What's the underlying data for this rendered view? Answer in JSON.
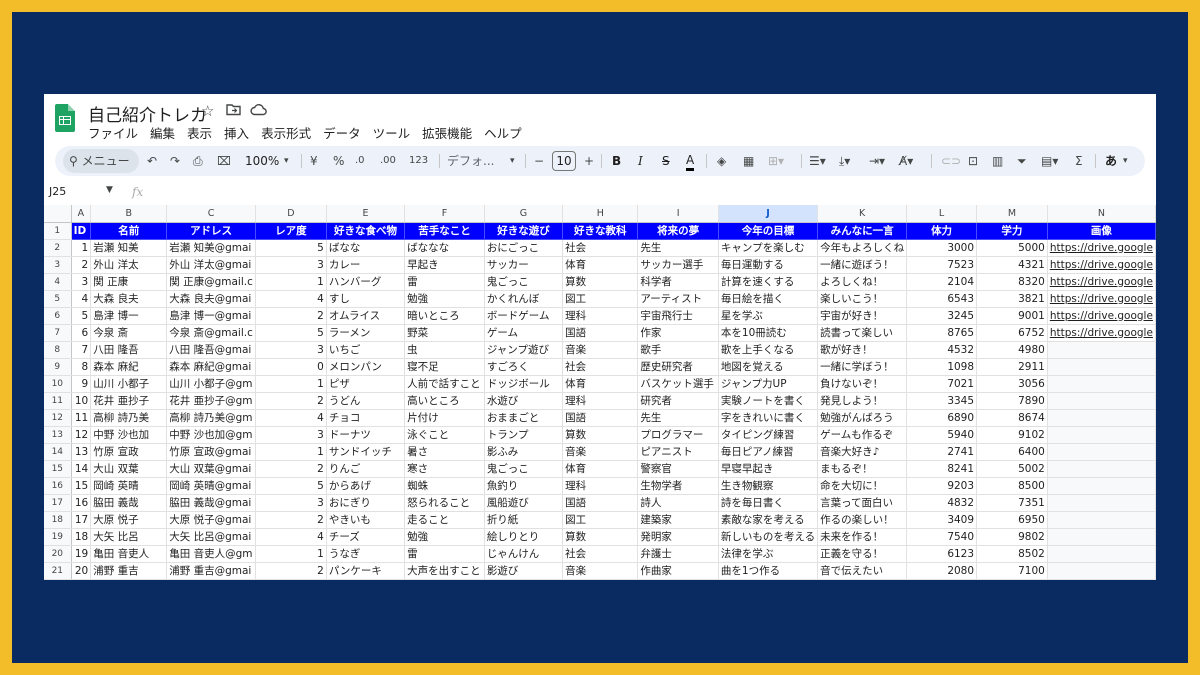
{
  "doc": {
    "title": "自己紹介トレカ"
  },
  "menu": [
    "ファイル",
    "編集",
    "表示",
    "挿入",
    "表示形式",
    "データ",
    "ツール",
    "拡張機能",
    "ヘルプ"
  ],
  "toolbar": {
    "search": "メニュー",
    "zoom": "100%",
    "currency": "¥",
    "percent": "%",
    "dec_decrease": ".0",
    "dec_increase": ".00",
    "num_format": "123",
    "font": "デフォ...",
    "font_size": "10",
    "minus": "−",
    "plus": "+",
    "bold": "B",
    "italic": "I",
    "strike": "S",
    "textcolor": "A",
    "sigma": "Σ",
    "input": "あ"
  },
  "formula_bar": {
    "cell_ref": "J25",
    "fx": "fx"
  },
  "columns": [
    "A",
    "B",
    "C",
    "D",
    "E",
    "F",
    "G",
    "H",
    "I",
    "J",
    "K",
    "L",
    "M",
    "N"
  ],
  "selected_column": "J",
  "header_row": [
    "ID",
    "名前",
    "アドレス",
    "レア度",
    "好きな食べ物",
    "苦手なこと",
    "好きな遊び",
    "好きな教科",
    "将来の夢",
    "今年の目標",
    "みんなに一言",
    "体力",
    "学力",
    "画像"
  ],
  "rows": [
    [
      "1",
      "岩瀬 知美",
      "岩瀬 知美@gmai",
      "5",
      "ばなな",
      "ばななな",
      "おにごっこ",
      "社会",
      "先生",
      "キャンプを楽しむ",
      "今年もよろしくね",
      "3000",
      "5000",
      "https://drive.google"
    ],
    [
      "2",
      "外山 洋太",
      "外山 洋太@gmai",
      "3",
      "カレー",
      "早起き",
      "サッカー",
      "体育",
      "サッカー選手",
      "毎日運動する",
      "一緒に遊ぼう！",
      "7523",
      "4321",
      "https://drive.google"
    ],
    [
      "3",
      "関 正康",
      "関 正康@gmail.c",
      "1",
      "ハンバーグ",
      "雷",
      "鬼ごっこ",
      "算数",
      "科学者",
      "計算を速くする",
      "よろしくね！",
      "2104",
      "8320",
      "https://drive.google"
    ],
    [
      "4",
      "大森 良夫",
      "大森 良夫@gmai",
      "4",
      "すし",
      "勉強",
      "かくれんぼ",
      "図工",
      "アーティスト",
      "毎日絵を描く",
      "楽しいこう！",
      "6543",
      "3821",
      "https://drive.google"
    ],
    [
      "5",
      "島津 博一",
      "島津 博一@gmai",
      "2",
      "オムライス",
      "暗いところ",
      "ボードゲーム",
      "理科",
      "宇宙飛行士",
      "星を学ぶ",
      "宇宙が好き！",
      "3245",
      "9001",
      "https://drive.google"
    ],
    [
      "6",
      "今泉 斎",
      "今泉 斎@gmail.c",
      "5",
      "ラーメン",
      "野菜",
      "ゲーム",
      "国語",
      "作家",
      "本を10冊読む",
      "読書って楽しい",
      "8765",
      "6752",
      "https://drive.google"
    ],
    [
      "7",
      "八田 隆吾",
      "八田 隆吾@gmai",
      "3",
      "いちご",
      "虫",
      "ジャンプ遊び",
      "音楽",
      "歌手",
      "歌を上手くなる",
      "歌が好き！",
      "4532",
      "4980",
      ""
    ],
    [
      "8",
      "森本 麻紀",
      "森本 麻紀@gmai",
      "0",
      "メロンパン",
      "寝不足",
      "すごろく",
      "社会",
      "歴史研究者",
      "地図を覚える",
      "一緒に学ぼう！",
      "1098",
      "2911",
      ""
    ],
    [
      "9",
      "山川 小都子",
      "山川 小都子@gm",
      "1",
      "ピザ",
      "人前で話すこと",
      "ドッジボール",
      "体育",
      "バスケット選手",
      "ジャンプ力UP",
      "負けないぞ！",
      "7021",
      "3056",
      ""
    ],
    [
      "10",
      "花井 亜抄子",
      "花井 亜抄子@gm",
      "2",
      "うどん",
      "高いところ",
      "水遊び",
      "理科",
      "研究者",
      "実験ノートを書く",
      "発見しよう！",
      "3345",
      "7890",
      ""
    ],
    [
      "11",
      "高柳 詩乃美",
      "高柳 詩乃美@gm",
      "4",
      "チョコ",
      "片付け",
      "おままごと",
      "国語",
      "先生",
      "字をきれいに書く",
      "勉強がんばろう",
      "6890",
      "8674",
      ""
    ],
    [
      "12",
      "中野 沙也加",
      "中野 沙也加@gm",
      "3",
      "ドーナツ",
      "泳ぐこと",
      "トランプ",
      "算数",
      "プログラマー",
      "タイピング練習",
      "ゲームも作るぞ",
      "5940",
      "9102",
      ""
    ],
    [
      "13",
      "竹原 宣政",
      "竹原 宣政@gmai",
      "1",
      "サンドイッチ",
      "暑さ",
      "影ふみ",
      "音楽",
      "ピアニスト",
      "毎日ピアノ練習",
      "音楽大好き♪",
      "2741",
      "6400",
      ""
    ],
    [
      "14",
      "大山 双葉",
      "大山 双葉@gmai",
      "2",
      "りんご",
      "寒さ",
      "鬼ごっこ",
      "体育",
      "警察官",
      "早寝早起き",
      "まもるぞ！",
      "8241",
      "5002",
      ""
    ],
    [
      "15",
      "岡崎 英晴",
      "岡崎 英晴@gmai",
      "5",
      "からあげ",
      "蜘蛛",
      "魚釣り",
      "理科",
      "生物学者",
      "生き物観察",
      "命を大切に！",
      "9203",
      "8500",
      ""
    ],
    [
      "16",
      "脇田 義哉",
      "脇田 義哉@gmai",
      "3",
      "おにぎり",
      "怒られること",
      "風船遊び",
      "国語",
      "詩人",
      "詩を毎日書く",
      "言葉って面白い",
      "4832",
      "7351",
      ""
    ],
    [
      "17",
      "大原 悦子",
      "大原 悦子@gmai",
      "2",
      "やきいも",
      "走ること",
      "折り紙",
      "図工",
      "建築家",
      "素敵な家を考える",
      "作るの楽しい！",
      "3409",
      "6950",
      ""
    ],
    [
      "18",
      "大矢 比呂",
      "大矢 比呂@gmai",
      "4",
      "チーズ",
      "勉強",
      "絵しりとり",
      "算数",
      "発明家",
      "新しいものを考える",
      "未来を作る！",
      "7540",
      "9802",
      ""
    ],
    [
      "19",
      "亀田 音吏人",
      "亀田 音吏人@gm",
      "1",
      "うなぎ",
      "雷",
      "じゃんけん",
      "社会",
      "弁護士",
      "法律を学ぶ",
      "正義を守る！",
      "6123",
      "8502",
      ""
    ],
    [
      "20",
      "浦野 重吉",
      "浦野 重吉@gmai",
      "2",
      "パンケーキ",
      "大声を出すこと",
      "影遊び",
      "音楽",
      "作曲家",
      "曲を1つ作る",
      "音で伝えたい",
      "2080",
      "7100",
      ""
    ]
  ],
  "colors": {
    "frame": "#0a2b61",
    "border": "#f2bd28",
    "header_fill": "#0000ff",
    "link": "#1155cc"
  }
}
